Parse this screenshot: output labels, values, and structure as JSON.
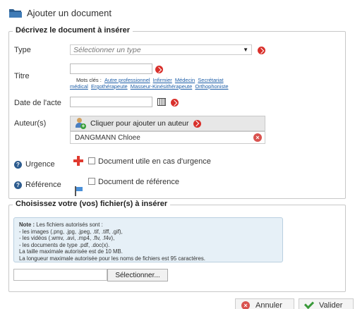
{
  "dialog": {
    "title": "Ajouter un document"
  },
  "section_document": {
    "legend": "Décrivez le document à insérer",
    "type": {
      "label": "Type",
      "placeholder": "Sélectionner un type"
    },
    "titre": {
      "label": "Titre",
      "value": "",
      "keywords_label": "Mots clés :",
      "keywords": [
        "Autre professionnel",
        "Infirmier",
        "Médecin",
        "Secrétariat",
        "médical",
        "Ergothérapeute",
        "Masseur-Kinésithérapeute",
        "Orthophoniste"
      ]
    },
    "date": {
      "label": "Date de l'acte",
      "value": ""
    },
    "auteurs": {
      "label": "Auteur(s)",
      "add_button_label": "Cliquer pour ajouter un auteur",
      "items": [
        "DANGMANN Chloee"
      ]
    },
    "urgence": {
      "label": "Urgence",
      "checkbox_label": "Document utile en cas d'urgence",
      "checked": false
    },
    "reference": {
      "label": "Référence",
      "checkbox_label": "Document de référence",
      "checked": false
    }
  },
  "section_files": {
    "legend": "Choisissez votre (vos) fichier(s) à insérer",
    "note_title": "Note :",
    "note_lines": [
      "Les fichiers autorisés sont :",
      "- les images (.png, .jpg, .jpeg, .tif, .tiff, .gif),",
      "- les vidéos (.wmv, .avi, .mp4, .flv, .f4v),",
      "- les documents de type .pdf, .doc(x).",
      "La taille maximale autorisée est de 10 MB.",
      "La longueur maximale autorisée pour les noms de fichiers est 95 caractères."
    ],
    "file_value": "",
    "browse_label": "Sélectionner..."
  },
  "footer": {
    "cancel_label": "Annuler",
    "confirm_label": "Valider"
  },
  "colors": {
    "accent_red": "#d9302b",
    "link_blue": "#1f5fa8",
    "note_bg": "#e6f0f7"
  }
}
